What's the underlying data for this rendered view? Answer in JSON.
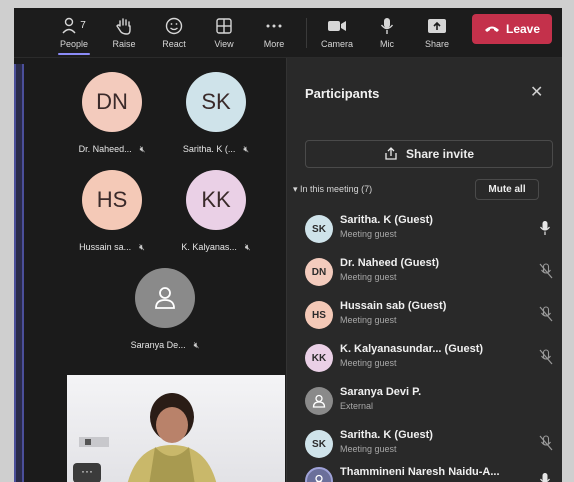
{
  "toolbar": {
    "people_label": "People",
    "people_count": "7",
    "raise_label": "Raise",
    "react_label": "React",
    "view_label": "View",
    "more_label": "More",
    "camera_label": "Camera",
    "mic_label": "Mic",
    "share_label": "Share",
    "leave_label": "Leave",
    "leave_color": "#c4314b",
    "active_accent": "#8b8cf7"
  },
  "stage": {
    "tiles": [
      {
        "initials": "DN",
        "name": "Dr. Naheed...",
        "color": "#f3cbbd"
      },
      {
        "initials": "SK",
        "name": "Saritha. K (...",
        "color": "#cfe3ea"
      },
      {
        "initials": "HS",
        "name": "Hussain sa...",
        "color": "#f4c9b7"
      },
      {
        "initials": "KK",
        "name": "K. Kalyanas...",
        "color": "#ead0e6"
      },
      {
        "initials": "",
        "name": "Saranya De...",
        "color": "#8a8a8a"
      }
    ],
    "video_more": "···"
  },
  "panel": {
    "title": "Participants",
    "share_invite": "Share invite",
    "section": "In this meeting (7)",
    "mute_all": "Mute all",
    "participants": [
      {
        "initials": "SK",
        "name": "Saritha. K (Guest)",
        "role": "Meeting guest",
        "color": "#cfe3ea",
        "mic": "on"
      },
      {
        "initials": "DN",
        "name": "Dr. Naheed (Guest)",
        "role": "Meeting guest",
        "color": "#f3cbbd",
        "mic": "muted"
      },
      {
        "initials": "HS",
        "name": "Hussain sab (Guest)",
        "role": "Meeting guest",
        "color": "#f4c9b7",
        "mic": "muted"
      },
      {
        "initials": "KK",
        "name": "K. Kalyanasundar... (Guest)",
        "role": "Meeting guest",
        "color": "#ead0e6",
        "mic": "muted"
      },
      {
        "initials": "",
        "name": "Saranya Devi P.",
        "role": "External",
        "color": "#8a8a8a",
        "mic": "none"
      },
      {
        "initials": "SK",
        "name": "Saritha. K (Guest)",
        "role": "Meeting guest",
        "color": "#cfe3ea",
        "mic": "muted"
      },
      {
        "initials": "",
        "name": "Thammineni Naresh Naidu-A...",
        "role": "",
        "color": "#6b6f9a",
        "mic": "on"
      }
    ]
  }
}
